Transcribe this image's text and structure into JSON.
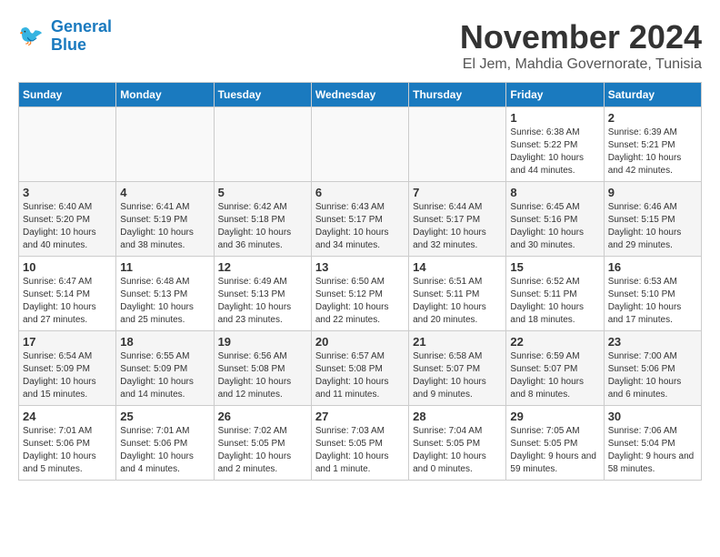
{
  "header": {
    "logo_line1": "General",
    "logo_line2": "Blue",
    "month": "November 2024",
    "location": "El Jem, Mahdia Governorate, Tunisia"
  },
  "weekdays": [
    "Sunday",
    "Monday",
    "Tuesday",
    "Wednesday",
    "Thursday",
    "Friday",
    "Saturday"
  ],
  "weeks": [
    [
      {
        "day": "",
        "info": ""
      },
      {
        "day": "",
        "info": ""
      },
      {
        "day": "",
        "info": ""
      },
      {
        "day": "",
        "info": ""
      },
      {
        "day": "",
        "info": ""
      },
      {
        "day": "1",
        "info": "Sunrise: 6:38 AM\nSunset: 5:22 PM\nDaylight: 10 hours and 44 minutes."
      },
      {
        "day": "2",
        "info": "Sunrise: 6:39 AM\nSunset: 5:21 PM\nDaylight: 10 hours and 42 minutes."
      }
    ],
    [
      {
        "day": "3",
        "info": "Sunrise: 6:40 AM\nSunset: 5:20 PM\nDaylight: 10 hours and 40 minutes."
      },
      {
        "day": "4",
        "info": "Sunrise: 6:41 AM\nSunset: 5:19 PM\nDaylight: 10 hours and 38 minutes."
      },
      {
        "day": "5",
        "info": "Sunrise: 6:42 AM\nSunset: 5:18 PM\nDaylight: 10 hours and 36 minutes."
      },
      {
        "day": "6",
        "info": "Sunrise: 6:43 AM\nSunset: 5:17 PM\nDaylight: 10 hours and 34 minutes."
      },
      {
        "day": "7",
        "info": "Sunrise: 6:44 AM\nSunset: 5:17 PM\nDaylight: 10 hours and 32 minutes."
      },
      {
        "day": "8",
        "info": "Sunrise: 6:45 AM\nSunset: 5:16 PM\nDaylight: 10 hours and 30 minutes."
      },
      {
        "day": "9",
        "info": "Sunrise: 6:46 AM\nSunset: 5:15 PM\nDaylight: 10 hours and 29 minutes."
      }
    ],
    [
      {
        "day": "10",
        "info": "Sunrise: 6:47 AM\nSunset: 5:14 PM\nDaylight: 10 hours and 27 minutes."
      },
      {
        "day": "11",
        "info": "Sunrise: 6:48 AM\nSunset: 5:13 PM\nDaylight: 10 hours and 25 minutes."
      },
      {
        "day": "12",
        "info": "Sunrise: 6:49 AM\nSunset: 5:13 PM\nDaylight: 10 hours and 23 minutes."
      },
      {
        "day": "13",
        "info": "Sunrise: 6:50 AM\nSunset: 5:12 PM\nDaylight: 10 hours and 22 minutes."
      },
      {
        "day": "14",
        "info": "Sunrise: 6:51 AM\nSunset: 5:11 PM\nDaylight: 10 hours and 20 minutes."
      },
      {
        "day": "15",
        "info": "Sunrise: 6:52 AM\nSunset: 5:11 PM\nDaylight: 10 hours and 18 minutes."
      },
      {
        "day": "16",
        "info": "Sunrise: 6:53 AM\nSunset: 5:10 PM\nDaylight: 10 hours and 17 minutes."
      }
    ],
    [
      {
        "day": "17",
        "info": "Sunrise: 6:54 AM\nSunset: 5:09 PM\nDaylight: 10 hours and 15 minutes."
      },
      {
        "day": "18",
        "info": "Sunrise: 6:55 AM\nSunset: 5:09 PM\nDaylight: 10 hours and 14 minutes."
      },
      {
        "day": "19",
        "info": "Sunrise: 6:56 AM\nSunset: 5:08 PM\nDaylight: 10 hours and 12 minutes."
      },
      {
        "day": "20",
        "info": "Sunrise: 6:57 AM\nSunset: 5:08 PM\nDaylight: 10 hours and 11 minutes."
      },
      {
        "day": "21",
        "info": "Sunrise: 6:58 AM\nSunset: 5:07 PM\nDaylight: 10 hours and 9 minutes."
      },
      {
        "day": "22",
        "info": "Sunrise: 6:59 AM\nSunset: 5:07 PM\nDaylight: 10 hours and 8 minutes."
      },
      {
        "day": "23",
        "info": "Sunrise: 7:00 AM\nSunset: 5:06 PM\nDaylight: 10 hours and 6 minutes."
      }
    ],
    [
      {
        "day": "24",
        "info": "Sunrise: 7:01 AM\nSunset: 5:06 PM\nDaylight: 10 hours and 5 minutes."
      },
      {
        "day": "25",
        "info": "Sunrise: 7:01 AM\nSunset: 5:06 PM\nDaylight: 10 hours and 4 minutes."
      },
      {
        "day": "26",
        "info": "Sunrise: 7:02 AM\nSunset: 5:05 PM\nDaylight: 10 hours and 2 minutes."
      },
      {
        "day": "27",
        "info": "Sunrise: 7:03 AM\nSunset: 5:05 PM\nDaylight: 10 hours and 1 minute."
      },
      {
        "day": "28",
        "info": "Sunrise: 7:04 AM\nSunset: 5:05 PM\nDaylight: 10 hours and 0 minutes."
      },
      {
        "day": "29",
        "info": "Sunrise: 7:05 AM\nSunset: 5:05 PM\nDaylight: 9 hours and 59 minutes."
      },
      {
        "day": "30",
        "info": "Sunrise: 7:06 AM\nSunset: 5:04 PM\nDaylight: 9 hours and 58 minutes."
      }
    ]
  ]
}
